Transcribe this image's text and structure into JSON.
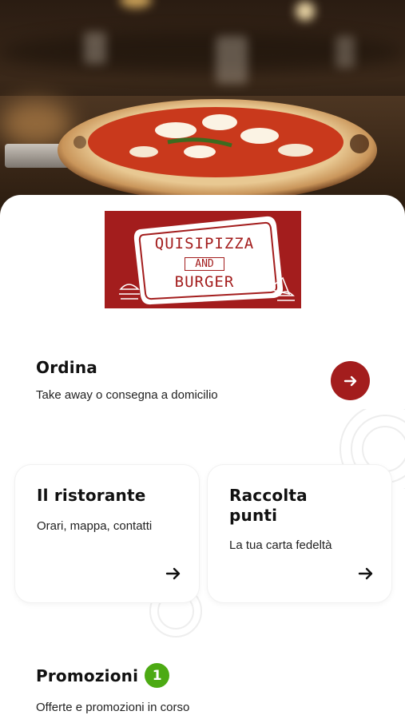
{
  "hero": {
    "image": "pizza-margherita-photo"
  },
  "logo": {
    "line1": "QUISIPIZZA",
    "line2": "AND",
    "line3": "BURGER",
    "bg_color": "#a31d1d"
  },
  "order": {
    "title": "Ordina",
    "subtitle": "Take away o consegna a domicilio",
    "icon": "arrow-right-icon",
    "button_color": "#a31d1d"
  },
  "cards": [
    {
      "title": "Il ristorante",
      "subtitle": "Orari, mappa, contatti",
      "icon": "arrow-right-icon"
    },
    {
      "title": "Raccolta punti",
      "subtitle": "La tua carta fedeltà",
      "icon": "arrow-right-icon"
    }
  ],
  "promo": {
    "title": "Promozioni",
    "badge": "1",
    "badge_color": "#4caa13",
    "subtitle": "Offerte e promozioni in corso"
  }
}
